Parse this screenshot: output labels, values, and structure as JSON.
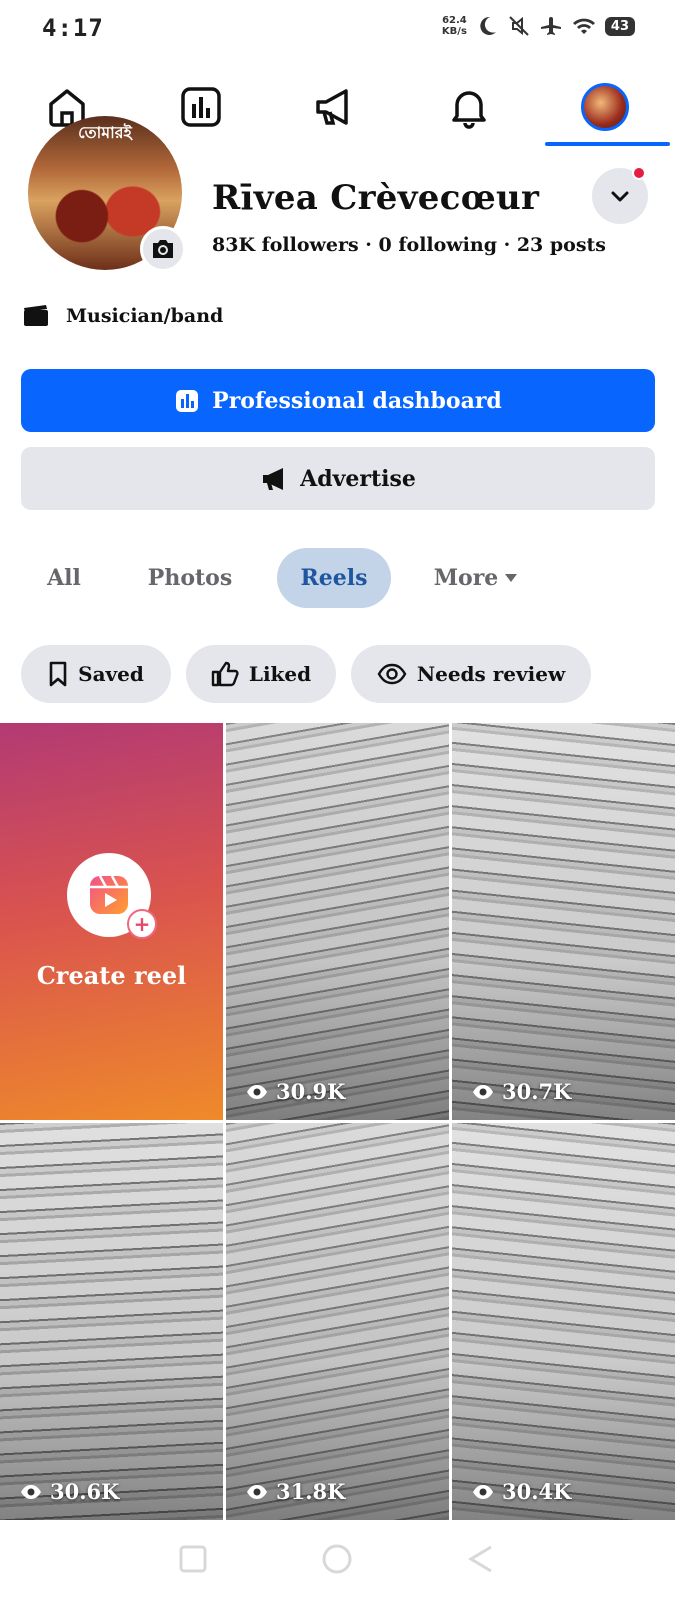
{
  "status_bar": {
    "time": "4:17",
    "net_speed_value": "62.4",
    "net_speed_unit": "KB/s",
    "battery": "43",
    "icons": [
      "moon-icon",
      "mute-icon",
      "airplane-icon",
      "wifi-icon",
      "battery-icon"
    ]
  },
  "top_nav": {
    "items": [
      "home-icon",
      "dashboard-icon",
      "megaphone-icon",
      "bell-icon",
      "profile-avatar"
    ],
    "active": "profile-avatar",
    "accent": "#0866ff"
  },
  "profile": {
    "picture_banner": "তোমারই",
    "name": "Rīvea Crèvecœur",
    "stats": "83K followers · 0 following · 23 posts",
    "category": "Musician/band"
  },
  "buttons": {
    "primary": "Professional dashboard",
    "secondary": "Advertise"
  },
  "tabs": [
    {
      "label": "All"
    },
    {
      "label": "Photos"
    },
    {
      "label": "Reels"
    },
    {
      "label": "More"
    }
  ],
  "active_tab": "Reels",
  "filters": [
    {
      "label": "Saved",
      "icon": "bookmark-icon"
    },
    {
      "label": "Liked",
      "icon": "thumbs-up-icon"
    },
    {
      "label": "Needs review",
      "icon": "eye-icon"
    }
  ],
  "grid": {
    "create_label": "Create reel",
    "reels": [
      {
        "views": "30.9K"
      },
      {
        "views": "30.7K"
      },
      {
        "views": "30.6K"
      },
      {
        "views": "31.8K"
      },
      {
        "views": "30.4K"
      }
    ]
  },
  "colors": {
    "primary_blue": "#0866ff",
    "chip_gray": "#e4e6eb",
    "active_tab_bg": "#c3d4e8",
    "active_tab_text": "#1e56a0"
  }
}
